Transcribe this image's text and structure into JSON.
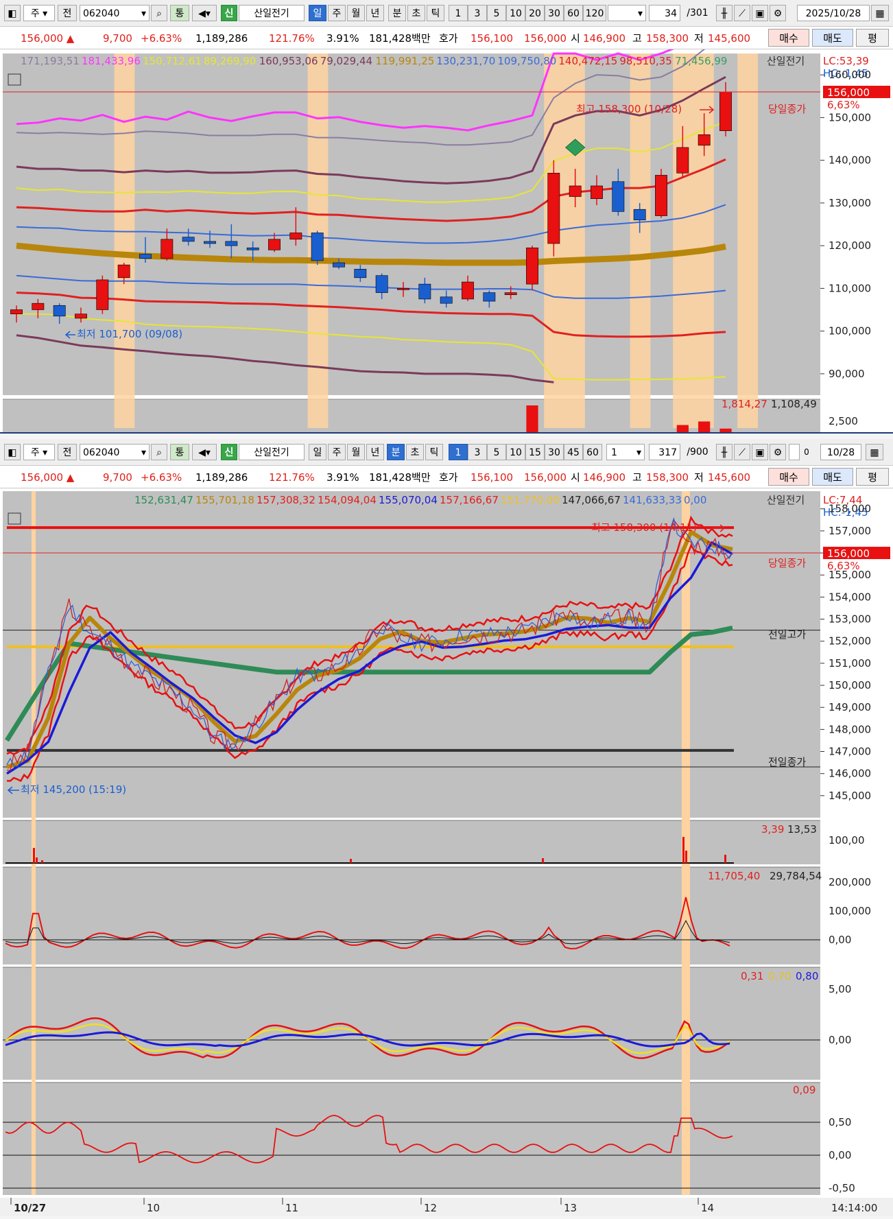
{
  "toolbar_top": {
    "market": "주",
    "prev": "전",
    "code": "062040",
    "tong": "통",
    "sin": "신",
    "name": "산일전기",
    "periods": [
      "일",
      "주",
      "월",
      "년",
      "분",
      "초",
      "틱"
    ],
    "nums": [
      "1",
      "3",
      "5",
      "10",
      "20",
      "30",
      "60",
      "120"
    ],
    "count": "34",
    "total": "/301",
    "date": "2025/10/28"
  },
  "toolbar_bottom": {
    "market": "주",
    "prev": "전",
    "code": "062040",
    "tong": "통",
    "sin": "신",
    "name": "산일전기",
    "periods": [
      "일",
      "주",
      "월",
      "년",
      "분",
      "초",
      "틱"
    ],
    "nums": [
      "1",
      "3",
      "5",
      "10",
      "15",
      "30",
      "45",
      "60"
    ],
    "interval": "1",
    "count": "317",
    "total": "/900",
    "check_label": "0",
    "date": "10/28"
  },
  "quote": {
    "price": "156,000 ▲",
    "change": "9,700",
    "pct": "+6.63%",
    "volume": "1,189,286",
    "vol_ratio": "121.76%",
    "turnover": "3.91%",
    "amount": "181,428백만",
    "ask_label": "호가",
    "ask1": "156,100",
    "ask2": "156,000",
    "open_label": "시",
    "open": "146,900",
    "high_label": "고",
    "high": "158,300",
    "low_label": "저",
    "low": "145,600",
    "buy": "매수",
    "sell": "매도",
    "eval": "평"
  },
  "daily": {
    "legend": [
      {
        "text": "171,193,51",
        "color": "#8a7da0"
      },
      {
        "text": "181,433,96",
        "color": "#ff33ff"
      },
      {
        "text": "150,712,61",
        "color": "#e6e633"
      },
      {
        "text": "89,269,90",
        "color": "#e6e633"
      },
      {
        "text": "160,953,06",
        "color": "#7a3a5a"
      },
      {
        "text": "79,029,44",
        "color": "#7a3a5a"
      },
      {
        "text": "119,991,25",
        "color": "#b8860b"
      },
      {
        "text": "130,231,70",
        "color": "#3a6ad8"
      },
      {
        "text": "109,750,80",
        "color": "#3a6ad8"
      },
      {
        "text": "140,472,15",
        "color": "#e02020"
      },
      {
        "text": "98,510,35",
        "color": "#e02020"
      },
      {
        "text": "71,456,99",
        "color": "#3aa060"
      }
    ],
    "name": "산일전기",
    "lc": "LC:53,39",
    "hc": "HC:-1,45",
    "hi_annot": "최고 158,300 (10/28)",
    "lo_annot": "최저 101,700 (09/08)",
    "close_label": "당일종가",
    "price_box": "156,000",
    "pct_box": "6,63%",
    "ticks": [
      "160,000",
      "150,000",
      "140,000",
      "130,000",
      "120,000",
      "110,000",
      "100,000",
      "90,000"
    ],
    "sub_legend_1": "1,814,27",
    "sub_legend_2": "1,108,49",
    "sub_tick": "2,500"
  },
  "minute": {
    "legend": [
      {
        "text": "152,631,47",
        "color": "#2e8b57"
      },
      {
        "text": "155,701,18",
        "color": "#b8860b"
      },
      {
        "text": "157,308,32",
        "color": "#e02020"
      },
      {
        "text": "154,094,04",
        "color": "#e02020"
      },
      {
        "text": "155,070,04",
        "color": "#1a1ad8"
      },
      {
        "text": "157,166,67",
        "color": "#e02020"
      },
      {
        "text": "151,770,00",
        "color": "#f0c020"
      },
      {
        "text": "147,066,67",
        "color": "#222222"
      },
      {
        "text": "141,633,33",
        "color": "#3a6ad8"
      },
      {
        "text": "0,00",
        "color": "#3a6ad8"
      }
    ],
    "name": "산일전기",
    "lc": "LC:7,44",
    "hc": "HC:-1,45",
    "hi_annot": "최고 158,300 (14:11)",
    "lo_annot": "최저 145,200 (15:19)",
    "close_label": "당일종가",
    "prev_high_label": "전일고가",
    "prev_close_label": "전일종가",
    "price_box": "156,000",
    "pct_box": "6,63%",
    "ticks": [
      "158,000",
      "157,000",
      "156,000",
      "155,000",
      "154,000",
      "153,000",
      "152,000",
      "151,000",
      "150,000",
      "149,000",
      "148,000",
      "147,000",
      "146,000",
      "145,000"
    ],
    "vol_legend_1": "3,39",
    "vol_legend_2": "13,53",
    "vol_tick": "100,00",
    "ind1_legend_1": "11,705,40",
    "ind1_legend_2": "29,784,54",
    "ind1_ticks": [
      "200,000",
      "100,000",
      "0,00"
    ],
    "ind2_legend": [
      "0,31",
      "0,70",
      "0,80"
    ],
    "ind2_ticks": [
      "5,00",
      "0,00"
    ],
    "ind3_legend": "0,09",
    "ind3_ticks": [
      "0,50",
      "0,00",
      "-0,50"
    ],
    "x_labels": [
      "10/27",
      "10",
      "11",
      "12",
      "13",
      "14"
    ],
    "time": "14:14:00"
  },
  "chart_data": [
    {
      "type": "candlestick",
      "title": "산일전기 일봉",
      "ylim": [
        85000,
        165000
      ],
      "candles": [
        {
          "o": 104000,
          "h": 106000,
          "l": 102000,
          "c": 105000
        },
        {
          "o": 105000,
          "h": 107500,
          "l": 103000,
          "c": 106500
        },
        {
          "o": 106000,
          "h": 106500,
          "l": 101700,
          "c": 103500
        },
        {
          "o": 103000,
          "h": 105500,
          "l": 102000,
          "c": 104000
        },
        {
          "o": 105000,
          "h": 113000,
          "l": 104000,
          "c": 112000
        },
        {
          "o": 112500,
          "h": 116000,
          "l": 111000,
          "c": 115500
        },
        {
          "o": 118000,
          "h": 122000,
          "l": 116000,
          "c": 117000
        },
        {
          "o": 117000,
          "h": 124000,
          "l": 116500,
          "c": 121500
        },
        {
          "o": 122000,
          "h": 124000,
          "l": 120000,
          "c": 121000
        },
        {
          "o": 121000,
          "h": 123500,
          "l": 119500,
          "c": 120500
        },
        {
          "o": 121000,
          "h": 125000,
          "l": 117000,
          "c": 120000
        },
        {
          "o": 119500,
          "h": 121000,
          "l": 116500,
          "c": 119000
        },
        {
          "o": 119000,
          "h": 123000,
          "l": 118500,
          "c": 121500
        },
        {
          "o": 121500,
          "h": 129000,
          "l": 120000,
          "c": 123000
        },
        {
          "o": 123000,
          "h": 123500,
          "l": 115500,
          "c": 116500
        },
        {
          "o": 116000,
          "h": 117000,
          "l": 114500,
          "c": 115000
        },
        {
          "o": 114500,
          "h": 115500,
          "l": 111500,
          "c": 112500
        },
        {
          "o": 113000,
          "h": 113500,
          "l": 107500,
          "c": 109000
        },
        {
          "o": 110000,
          "h": 111500,
          "l": 108000,
          "c": 110000
        },
        {
          "o": 111000,
          "h": 112500,
          "l": 106500,
          "c": 107500
        },
        {
          "o": 108000,
          "h": 109500,
          "l": 105500,
          "c": 106500
        },
        {
          "o": 107500,
          "h": 113000,
          "l": 107000,
          "c": 111500
        },
        {
          "o": 109000,
          "h": 109500,
          "l": 105500,
          "c": 107000
        },
        {
          "o": 108500,
          "h": 110500,
          "l": 107500,
          "c": 109000
        },
        {
          "o": 111000,
          "h": 120000,
          "l": 109500,
          "c": 119500
        },
        {
          "o": 120500,
          "h": 140000,
          "l": 117500,
          "c": 137000
        },
        {
          "o": 131500,
          "h": 138000,
          "l": 129000,
          "c": 134000
        },
        {
          "o": 131000,
          "h": 136500,
          "l": 129500,
          "c": 134000
        },
        {
          "o": 135000,
          "h": 138000,
          "l": 127000,
          "c": 128000
        },
        {
          "o": 128500,
          "h": 130000,
          "l": 123000,
          "c": 126000
        },
        {
          "o": 127000,
          "h": 138000,
          "l": 126500,
          "c": 136500
        },
        {
          "o": 137000,
          "h": 148000,
          "l": 136000,
          "c": 143000
        },
        {
          "o": 143500,
          "h": 151000,
          "l": 141000,
          "c": 146000
        },
        {
          "o": 146900,
          "h": 158300,
          "l": 145600,
          "c": 156000
        }
      ]
    },
    {
      "type": "line",
      "title": "산일전기 1분봉",
      "ylim": [
        144000,
        158800
      ],
      "x": [
        "10/27",
        "10",
        "11",
        "12",
        "13",
        "14"
      ],
      "series": [
        {
          "name": "price",
          "values": [
            146300,
            146900,
            150500,
            153600,
            152400,
            151800,
            150900,
            150300,
            149700,
            148900,
            147600,
            147300,
            148200,
            149300,
            150400,
            150500,
            150900,
            151600,
            152700,
            152100,
            151900,
            152000,
            152300,
            152300,
            152400,
            152500,
            152900,
            153300,
            152700,
            153000,
            153100,
            152600,
            157400,
            156400,
            156300,
            156000
          ]
        }
      ]
    }
  ]
}
